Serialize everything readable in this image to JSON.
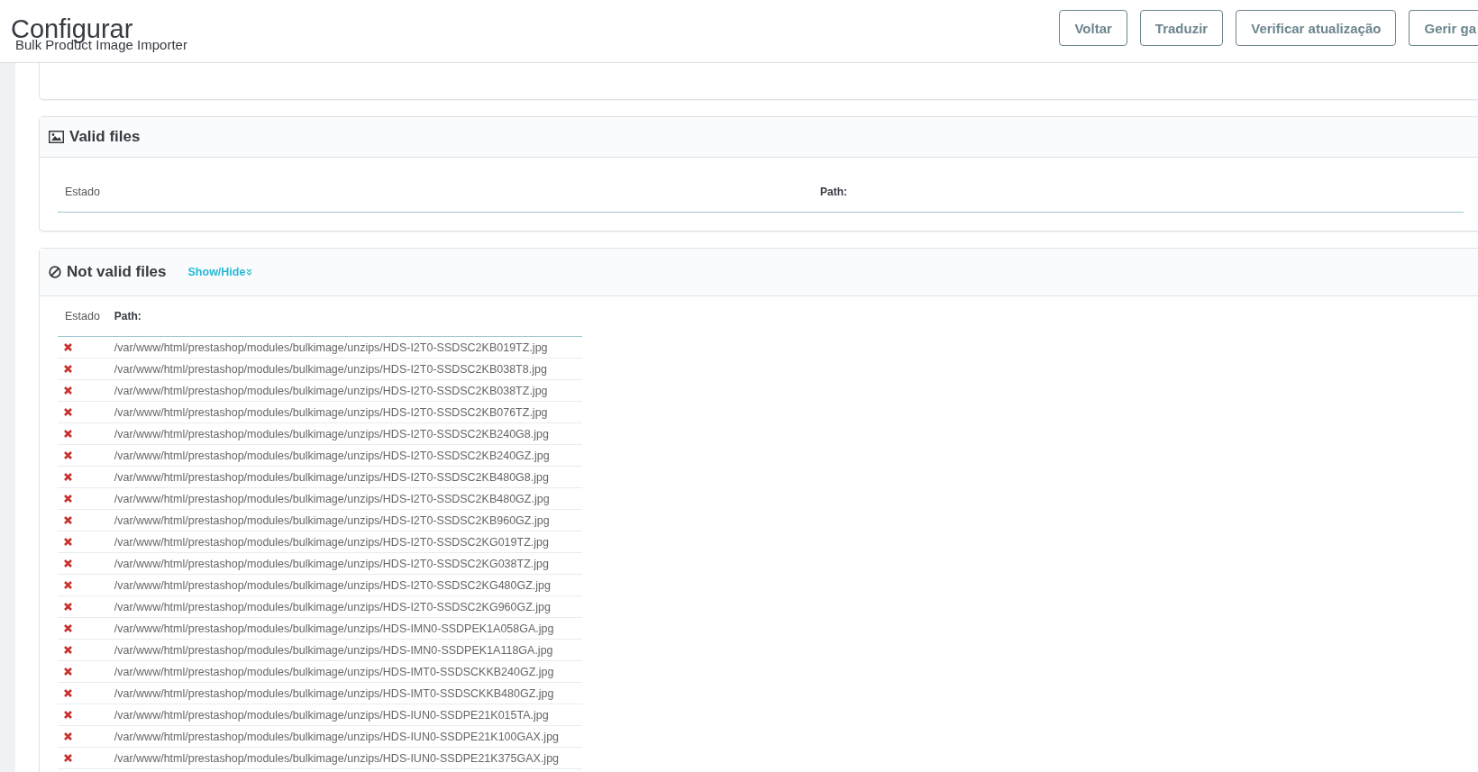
{
  "header": {
    "title": "Configurar",
    "subtitle": "Bulk Product Image Importer",
    "buttons": [
      "Voltar",
      "Traduzir",
      "Verificar atualização",
      "Gerir ga"
    ]
  },
  "valid_panel": {
    "title": "Valid files",
    "columns": [
      "Estado",
      "Path:"
    ]
  },
  "invalid_panel": {
    "title": "Not valid files",
    "toggle": "Show/Hide",
    "columns": [
      "Estado",
      "Path:"
    ],
    "rows": [
      {
        "valid": false,
        "path": "/var/www/html/prestashop/modules/bulkimage/unzips/HDS-I2T0-SSDSC2KB019TZ.jpg"
      },
      {
        "valid": false,
        "path": "/var/www/html/prestashop/modules/bulkimage/unzips/HDS-I2T0-SSDSC2KB038T8.jpg"
      },
      {
        "valid": false,
        "path": "/var/www/html/prestashop/modules/bulkimage/unzips/HDS-I2T0-SSDSC2KB038TZ.jpg"
      },
      {
        "valid": false,
        "path": "/var/www/html/prestashop/modules/bulkimage/unzips/HDS-I2T0-SSDSC2KB076TZ.jpg"
      },
      {
        "valid": false,
        "path": "/var/www/html/prestashop/modules/bulkimage/unzips/HDS-I2T0-SSDSC2KB240G8.jpg"
      },
      {
        "valid": false,
        "path": "/var/www/html/prestashop/modules/bulkimage/unzips/HDS-I2T0-SSDSC2KB240GZ.jpg"
      },
      {
        "valid": false,
        "path": "/var/www/html/prestashop/modules/bulkimage/unzips/HDS-I2T0-SSDSC2KB480G8.jpg"
      },
      {
        "valid": false,
        "path": "/var/www/html/prestashop/modules/bulkimage/unzips/HDS-I2T0-SSDSC2KB480GZ.jpg"
      },
      {
        "valid": false,
        "path": "/var/www/html/prestashop/modules/bulkimage/unzips/HDS-I2T0-SSDSC2KB960GZ.jpg"
      },
      {
        "valid": false,
        "path": "/var/www/html/prestashop/modules/bulkimage/unzips/HDS-I2T0-SSDSC2KG019TZ.jpg"
      },
      {
        "valid": false,
        "path": "/var/www/html/prestashop/modules/bulkimage/unzips/HDS-I2T0-SSDSC2KG038TZ.jpg"
      },
      {
        "valid": false,
        "path": "/var/www/html/prestashop/modules/bulkimage/unzips/HDS-I2T0-SSDSC2KG480GZ.jpg"
      },
      {
        "valid": false,
        "path": "/var/www/html/prestashop/modules/bulkimage/unzips/HDS-I2T0-SSDSC2KG960GZ.jpg"
      },
      {
        "valid": false,
        "path": "/var/www/html/prestashop/modules/bulkimage/unzips/HDS-IMN0-SSDPEK1A058GA.jpg"
      },
      {
        "valid": false,
        "path": "/var/www/html/prestashop/modules/bulkimage/unzips/HDS-IMN0-SSDPEK1A118GA.jpg"
      },
      {
        "valid": false,
        "path": "/var/www/html/prestashop/modules/bulkimage/unzips/HDS-IMT0-SSDSCKKB240GZ.jpg"
      },
      {
        "valid": false,
        "path": "/var/www/html/prestashop/modules/bulkimage/unzips/HDS-IMT0-SSDSCKKB480GZ.jpg"
      },
      {
        "valid": false,
        "path": "/var/www/html/prestashop/modules/bulkimage/unzips/HDS-IUN0-SSDPE21K015TA.jpg"
      },
      {
        "valid": false,
        "path": "/var/www/html/prestashop/modules/bulkimage/unzips/HDS-IUN0-SSDPE21K100GAX.jpg"
      },
      {
        "valid": false,
        "path": "/var/www/html/prestashop/modules/bulkimage/unzips/HDS-IUN0-SSDPE21K375GAX.jpg"
      }
    ]
  }
}
